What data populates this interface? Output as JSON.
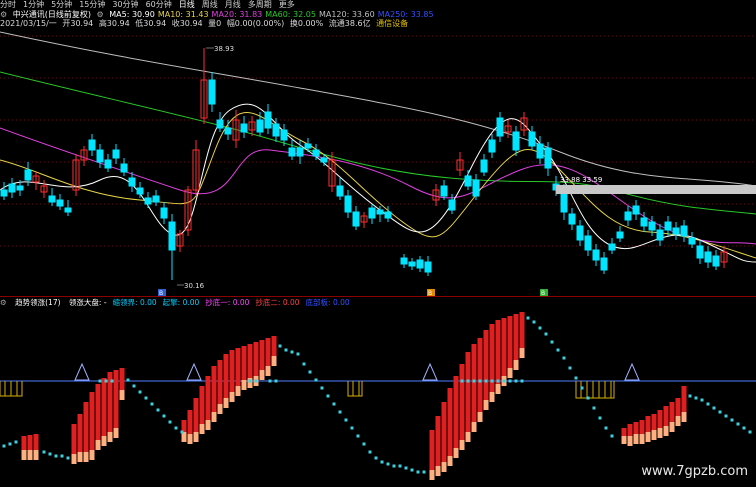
{
  "period_bar": {
    "items": [
      "分时",
      "1分钟",
      "5分钟",
      "15分钟",
      "30分钟",
      "60分钟",
      "日线",
      "周线",
      "月线",
      "多周期",
      "更多"
    ],
    "selected": "日线"
  },
  "legend": {
    "name": "中兴通讯(日线前复权)",
    "ma": [
      {
        "label": "MA5: 30.90",
        "color": "#ffffff"
      },
      {
        "label": "MA10: 31.43",
        "color": "#e8d44a"
      },
      {
        "label": "MA20: 31.83",
        "color": "#e040e0"
      },
      {
        "label": "MA60: 32.05",
        "color": "#28c828"
      },
      {
        "label": "MA120: 33.60",
        "color": "#bfbfbf"
      },
      {
        "label": "MA250: 33.85",
        "color": "#3050ff"
      }
    ]
  },
  "info": {
    "date": "2021/03/15/一",
    "open": "开30.94",
    "high": "高30.94",
    "low": "低30.94",
    "close": "收30.94",
    "vol": "量0",
    "change": "幅0.00(0.00%)",
    "turnover": "换0.00%",
    "float_cap": "流通38.6亿",
    "sector": "通信设备",
    "sector_color": "#e0c000"
  },
  "chart_labels": {
    "high_price": "38.93",
    "low_price": "30.16",
    "right_marker": "33.88  33.59",
    "sell_badge": "B",
    "buy_badge_1": "B",
    "buy_badge_2": "B"
  },
  "indicator": {
    "title": "趋势领涨(17)",
    "items": [
      {
        "label": "领涨大盘: -",
        "color": "#ffffff"
      },
      {
        "label": "缩领界: 0.00",
        "color": "#00cfff"
      },
      {
        "label": "起擎: 0.00",
        "color": "#00cfff"
      },
      {
        "label": "抄底一: 0.00",
        "color": "#ff40ff"
      },
      {
        "label": "抄底二: 0.00",
        "color": "#ff4040"
      },
      {
        "label": "底部板: 0.00",
        "color": "#3050ff"
      }
    ]
  },
  "watermark": "www.7gpzb.com",
  "colors": {
    "up": "#ff3030",
    "down": "#00e5ff",
    "bars_red": "#e02020",
    "bars_light": "#ffb080",
    "dots": "#40d0e0",
    "baseline": "#5080ff",
    "steps": "#d8b000"
  }
}
